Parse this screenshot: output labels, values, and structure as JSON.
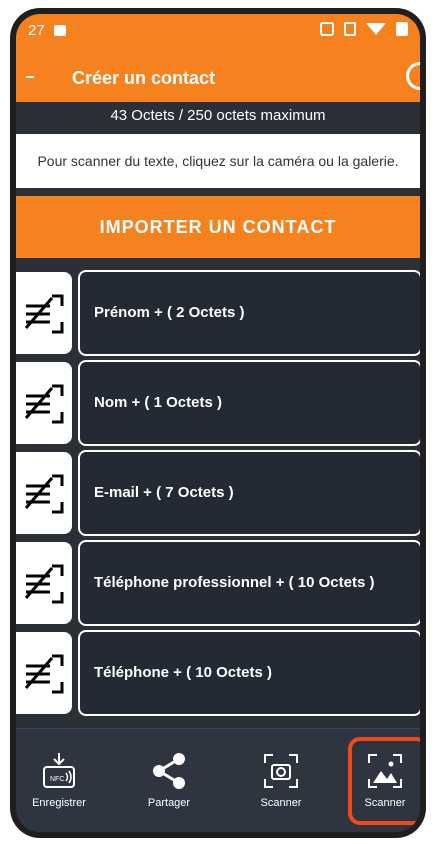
{
  "status": {
    "time": "27"
  },
  "header": {
    "title": "Créer un contact"
  },
  "bytes_info": "43 Octets / 250 octets maximum",
  "hint": "Pour scanner du texte, cliquez sur la caméra ou la galerie.",
  "import_button": "IMPORTER UN CONTACT",
  "fields": [
    {
      "label": "Prénom + ( 2 Octets )"
    },
    {
      "label": "Nom + ( 1 Octets )"
    },
    {
      "label": "E-mail + ( 7 Octets )"
    },
    {
      "label": "Téléphone professionnel + ( 10 Octets )"
    },
    {
      "label": "Téléphone  + ( 10 Octets )"
    }
  ],
  "bottom_nav": [
    {
      "label": "Enregistrer",
      "icon": "nfc-save-icon"
    },
    {
      "label": "Partager",
      "icon": "share-icon"
    },
    {
      "label": "Scanner",
      "icon": "camera-scan-icon"
    },
    {
      "label": "Scanner",
      "icon": "gallery-scan-icon"
    }
  ],
  "colors": {
    "accent": "#f5821f",
    "background": "#2b2f36",
    "highlight": "#f04a1a"
  }
}
